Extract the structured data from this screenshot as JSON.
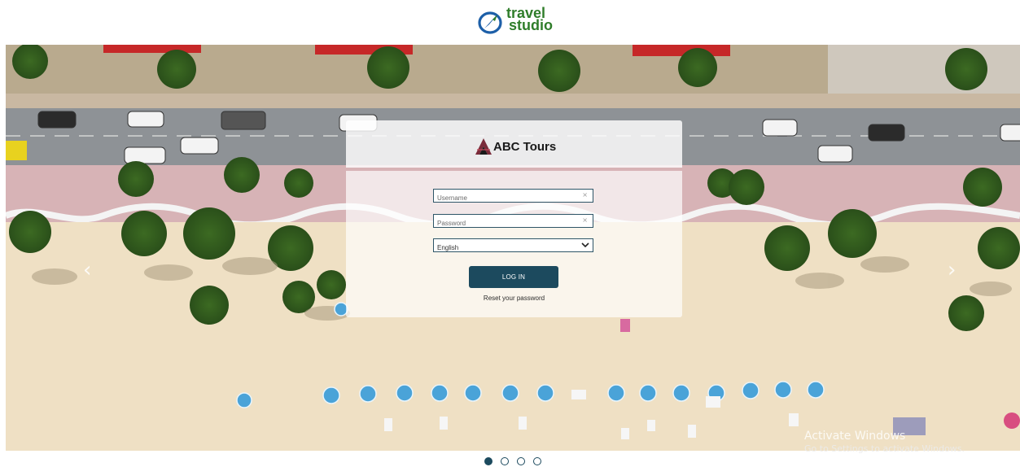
{
  "header": {
    "logo_line1": "travel",
    "logo_line2": "studio",
    "logo_icon": "compass-icon"
  },
  "carousel": {
    "prev_icon": "chevron-left-icon",
    "next_icon": "chevron-right-icon",
    "slide_count": 4,
    "active_slide": 1
  },
  "login": {
    "brand_name": "ABC Tours",
    "brand_icon": "abc-tours-logo-icon",
    "username_placeholder": "Username",
    "password_placeholder": "Password",
    "clear_glyph": "×",
    "language_selected": "English",
    "login_label": "LOG IN",
    "reset_label": "Reset your password"
  },
  "watermark": {
    "line1": "Activate Windows",
    "line2": "Go to Settings to activate Windows."
  },
  "colors": {
    "primary": "#1c4a5e",
    "logo_green": "#2f7d2a",
    "logo_blue": "#1d5fa8",
    "sand": "#efe0c4",
    "road": "#8e9296",
    "umbrella": "#4aa3d8"
  }
}
